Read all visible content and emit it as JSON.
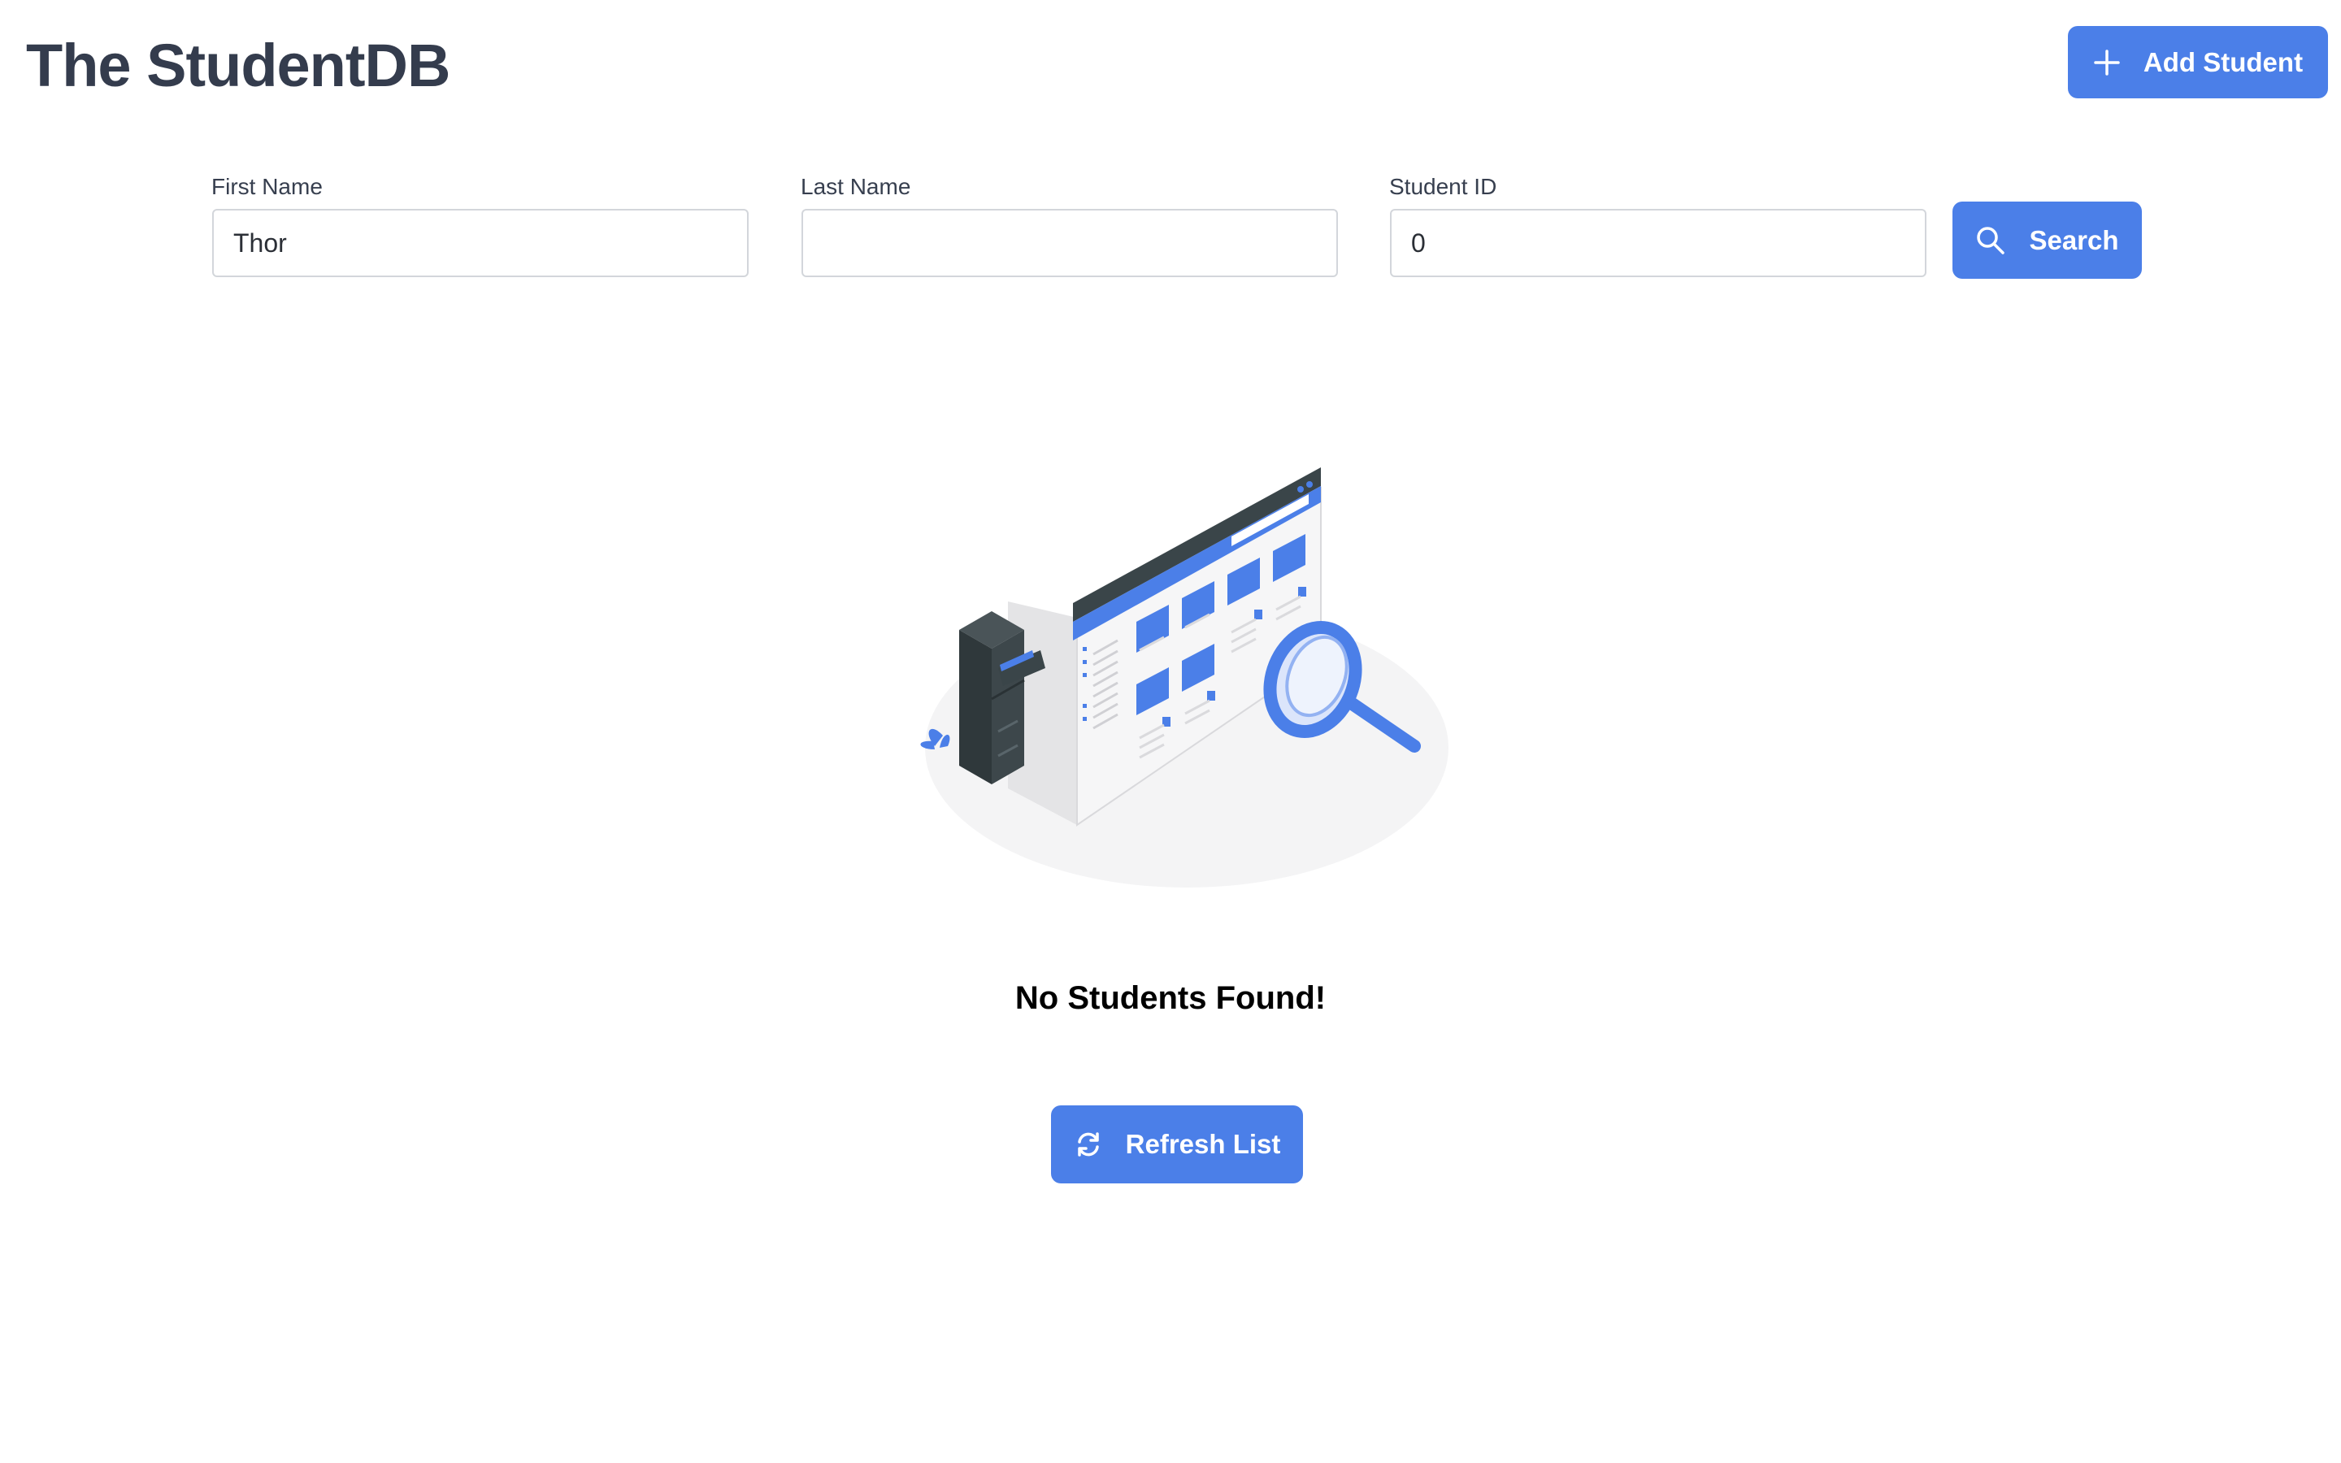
{
  "header": {
    "title": "The StudentDB",
    "add_button_label": "Add Student",
    "add_icon": "plus-icon"
  },
  "search": {
    "first_name": {
      "label": "First Name",
      "value": "Thor"
    },
    "last_name": {
      "label": "Last Name",
      "value": ""
    },
    "student_id": {
      "label": "Student ID",
      "value": "0"
    },
    "button_label": "Search",
    "button_icon": "search-icon"
  },
  "results": {
    "empty_message": "No Students Found!",
    "illustration": "empty-search-illustration",
    "refresh_button_label": "Refresh List",
    "refresh_icon": "refresh-icon"
  },
  "colors": {
    "accent": "#4b7fe8",
    "title": "#343c4d",
    "input_border": "#d3d6db"
  }
}
